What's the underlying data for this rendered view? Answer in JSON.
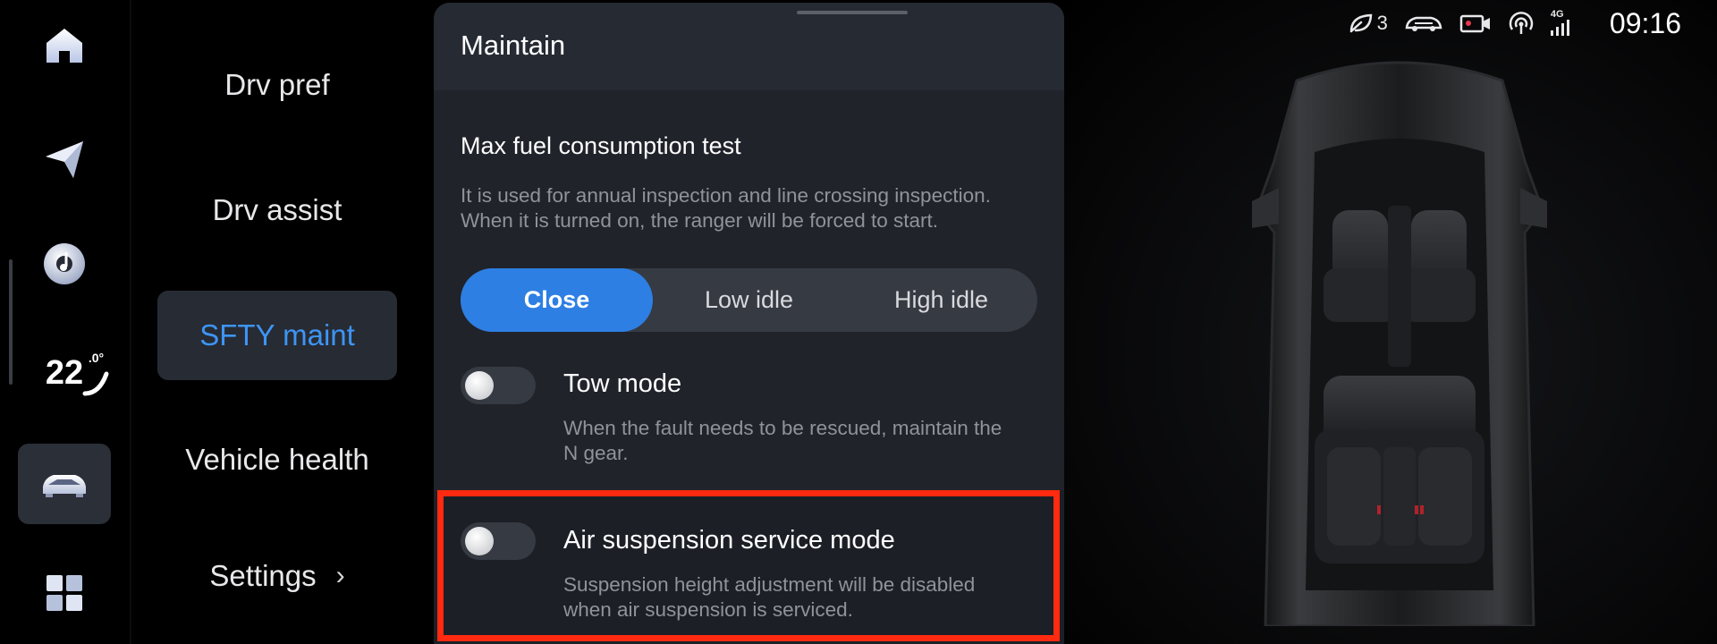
{
  "rail": {
    "items": [
      {
        "icon": "home-icon"
      },
      {
        "icon": "navigation-icon"
      },
      {
        "icon": "music-icon"
      },
      {
        "icon": "climate-icon",
        "temperature": "22",
        "unit": ".0°"
      },
      {
        "icon": "car-icon",
        "active": true
      },
      {
        "icon": "apps-grid-icon"
      }
    ]
  },
  "menu": {
    "items": [
      {
        "label": "Drv pref"
      },
      {
        "label": "Drv assist"
      },
      {
        "label": "SFTY maint",
        "active": true
      },
      {
        "label": "Vehicle health"
      },
      {
        "label": "Settings",
        "chevron": "›"
      }
    ]
  },
  "panel": {
    "title": "Maintain",
    "fuel_test": {
      "title": "Max fuel consumption test",
      "desc_line1": "It is used for annual inspection and line crossing inspection.",
      "desc_line2": "When it is turned on, the ranger will be forced to start.",
      "options": [
        "Close",
        "Low idle",
        "High idle"
      ],
      "selected": "Close"
    },
    "tow_mode": {
      "title": "Tow mode",
      "desc_line1": "When the fault needs to be rescued, maintain the",
      "desc_line2": "N gear.",
      "enabled": false
    },
    "air_suspension": {
      "title": "Air suspension service mode",
      "desc_line1": "Suspension height adjustment will be disabled",
      "desc_line2": "when air suspension is serviced.",
      "enabled": false
    }
  },
  "status_bar": {
    "eco_count": "3",
    "network": "4G",
    "time": "09:16"
  },
  "colors": {
    "accent": "#3d95f5",
    "selected_segment": "#2d7fe3",
    "highlight_border": "#ff2a0f"
  }
}
